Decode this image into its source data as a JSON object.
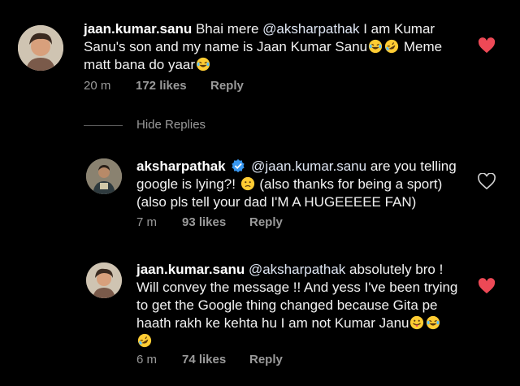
{
  "colors": {
    "background": "#000000",
    "text": "#f2f2f2",
    "meta": "#9a9a9a",
    "heart_liked": "#ed4956",
    "verified": "#3897f0"
  },
  "comments": [
    {
      "username": "jaan.kumar.sanu",
      "line1_text": " Bhai mere ",
      "line1_mention": "@aksharpathak",
      "line1_tail": " I am Kumar",
      "line2_text": "Sanu's son and my name is Jaan Kumar Sanu",
      "line2_emoji": [
        "laughing-emoji",
        "rofl-emoji"
      ],
      "line2_tail": " Meme",
      "line3_text": "matt bana do yaar",
      "line3_emoji": [
        "laughing-emoji"
      ],
      "time": "20 m",
      "likes": "172 likes",
      "reply": "Reply",
      "liked": true
    },
    {
      "username": "aksharpathak",
      "verified": true,
      "line1_mention": "@jaan.kumar.sanu",
      "line1_tail": " are you telling",
      "line2_text": "google is lying?!",
      "line2_emoji": [
        "confused-emoji"
      ],
      "line2_tail": " (also thanks for being a sport)",
      "line3_text": "(also pls tell your dad I'M A HUGEEEEE FAN)",
      "time": "7 m",
      "likes": "93 likes",
      "reply": "Reply",
      "liked": false
    },
    {
      "username": "jaan.kumar.sanu",
      "line1_mention": "@aksharpathak",
      "line1_tail": " absolutely bro !",
      "line2_text": "Will convey the message !! And yess I've been trying",
      "line3_text": "to get the Google thing changed because Gita pe",
      "line4_text": "haath rakh ke kehta hu I am not Kumar Janu",
      "line4_emoji": [
        "tongue-emoji",
        "laughing-emoji"
      ],
      "line5_emoji": [
        "rofl-emoji"
      ],
      "time": "6 m",
      "likes": "74 likes",
      "reply": "Reply",
      "liked": true
    }
  ],
  "hide_replies": "Hide Replies"
}
